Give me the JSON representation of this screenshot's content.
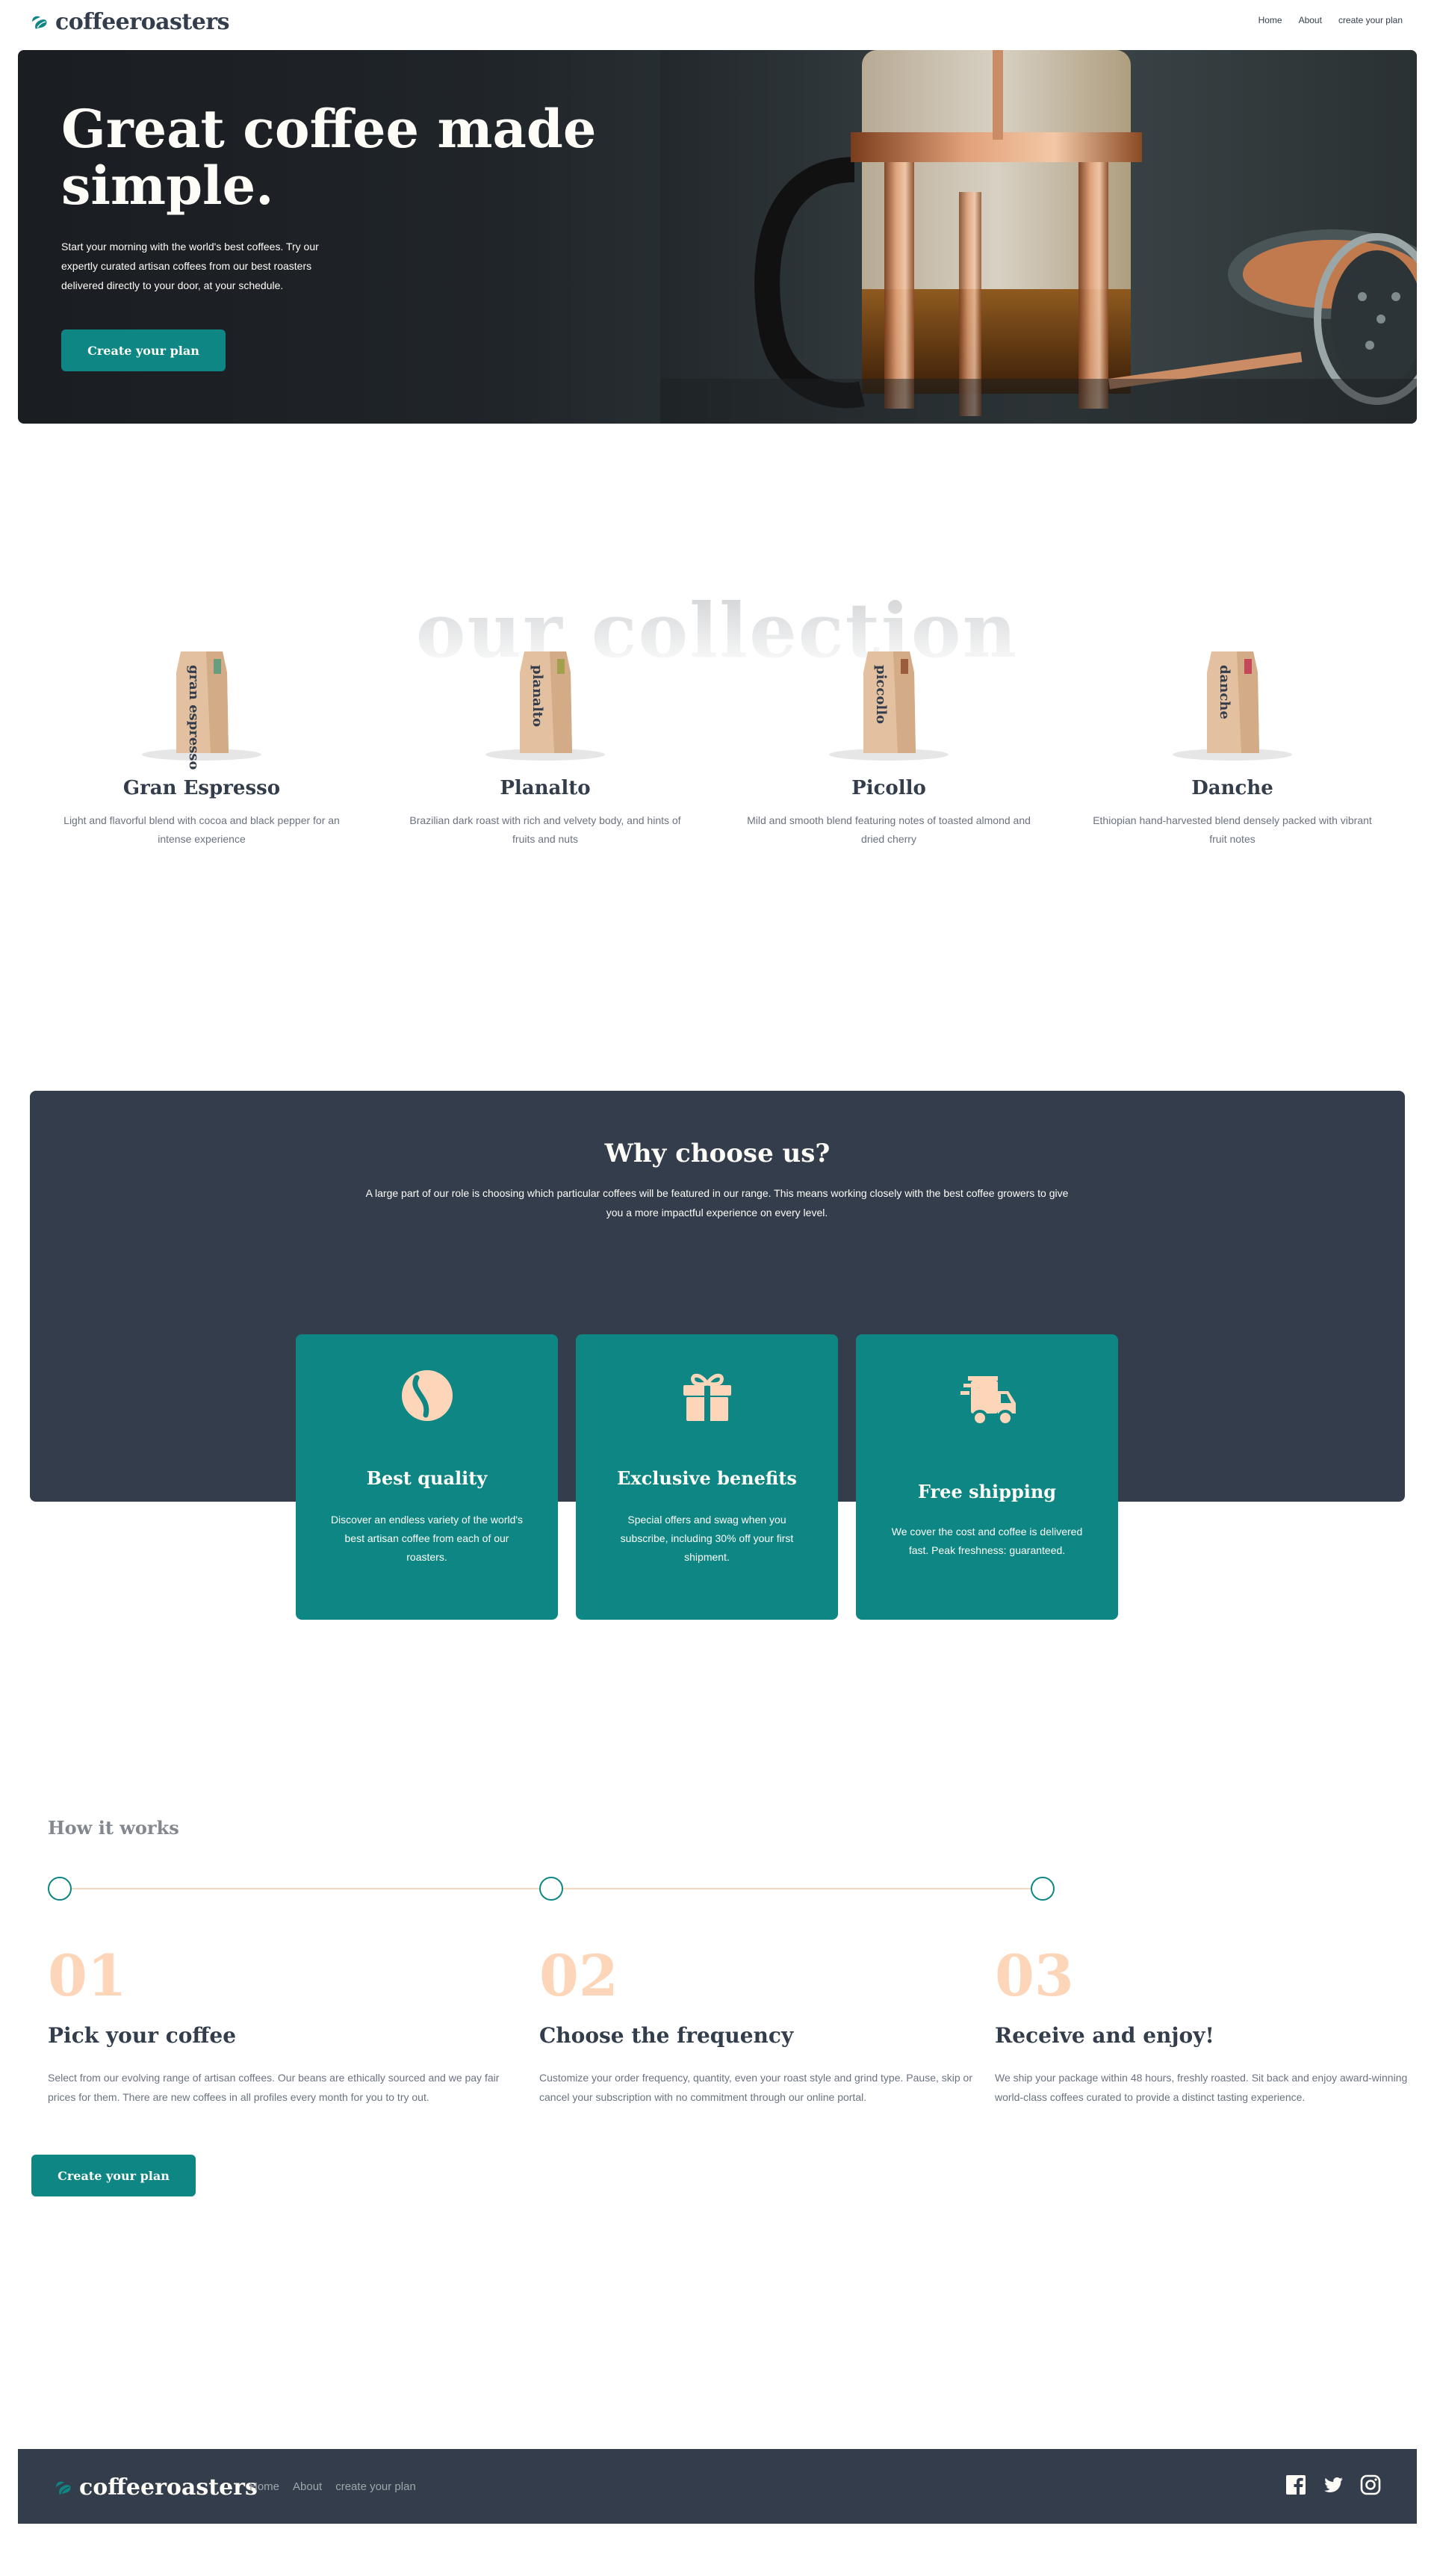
{
  "brand": {
    "name": "coffeeroasters"
  },
  "nav": {
    "links": [
      "Home",
      "About",
      "create your plan"
    ]
  },
  "hero": {
    "title": "Great coffee made simple.",
    "text": "Start your morning with the world's best coffees. Try our expertly curated artisan coffees from our best roasters delivered directly to your door, at your schedule.",
    "cta": "Create your plan"
  },
  "collection": {
    "title": "our collection",
    "items": [
      {
        "name": "Gran Espresso",
        "bag_label": "gran espresso",
        "accent": "#6a9c7e",
        "desc": "Light and flavorful blend with cocoa and black pepper for an intense experience"
      },
      {
        "name": "Planalto",
        "bag_label": "planalto",
        "accent": "#a2a04d",
        "desc": "Brazilian dark roast with rich and velvety body, and hints of fruits and nuts"
      },
      {
        "name": "Picollo",
        "bag_label": "piccollo",
        "accent": "#9b5b3c",
        "desc": "Mild and smooth blend featuring notes of toasted almond and dried cherry"
      },
      {
        "name": "Danche",
        "bag_label": "danche",
        "accent": "#c3495a",
        "desc": "Ethiopian hand-harvested blend densely packed with vibrant fruit notes"
      }
    ]
  },
  "why": {
    "title": "Why choose us?",
    "text": "A large part of our role is choosing which particular coffees will be featured in our range. This means working closely with the best coffee growers to give you a more impactful experience on every level.",
    "cards": [
      {
        "icon": "coffee-bean-icon",
        "title": "Best quality",
        "text": "Discover an endless variety of the world's best artisan coffee from each of our roasters."
      },
      {
        "icon": "gift-icon",
        "title": "Exclusive benefits",
        "text": "Special offers and swag when you subscribe, including 30% off your first shipment."
      },
      {
        "icon": "truck-icon",
        "title": "Free shipping",
        "text": "We cover the cost and coffee is delivered fast. Peak freshness: guaranteed."
      }
    ]
  },
  "how": {
    "title": "How it works",
    "steps": [
      {
        "num": "01",
        "title": "Pick your coffee",
        "text": "Select from our evolving range of artisan coffees. Our beans are ethically sourced and we pay fair prices for them. There are new coffees in all profiles every month for you to try out."
      },
      {
        "num": "02",
        "title": "Choose the frequency",
        "text": "Customize your order frequency, quantity, even your roast style and grind type. Pause, skip or cancel your subscription with no commitment through our online portal."
      },
      {
        "num": "03",
        "title": "Receive and enjoy!",
        "text": "We ship your package within 48 hours, freshly roasted. Sit back and enjoy award-winning world-class coffees curated to provide a distinct tasting experience."
      }
    ],
    "cta": "Create your plan"
  },
  "footer": {
    "links": [
      "Home",
      "About",
      "create your plan"
    ],
    "social": [
      "facebook-icon",
      "twitter-icon",
      "instagram-icon"
    ]
  },
  "colors": {
    "dark": "#333d4b",
    "teal": "#0e8784",
    "peach": "#fdd6ba",
    "cream": "#fefcf7"
  }
}
